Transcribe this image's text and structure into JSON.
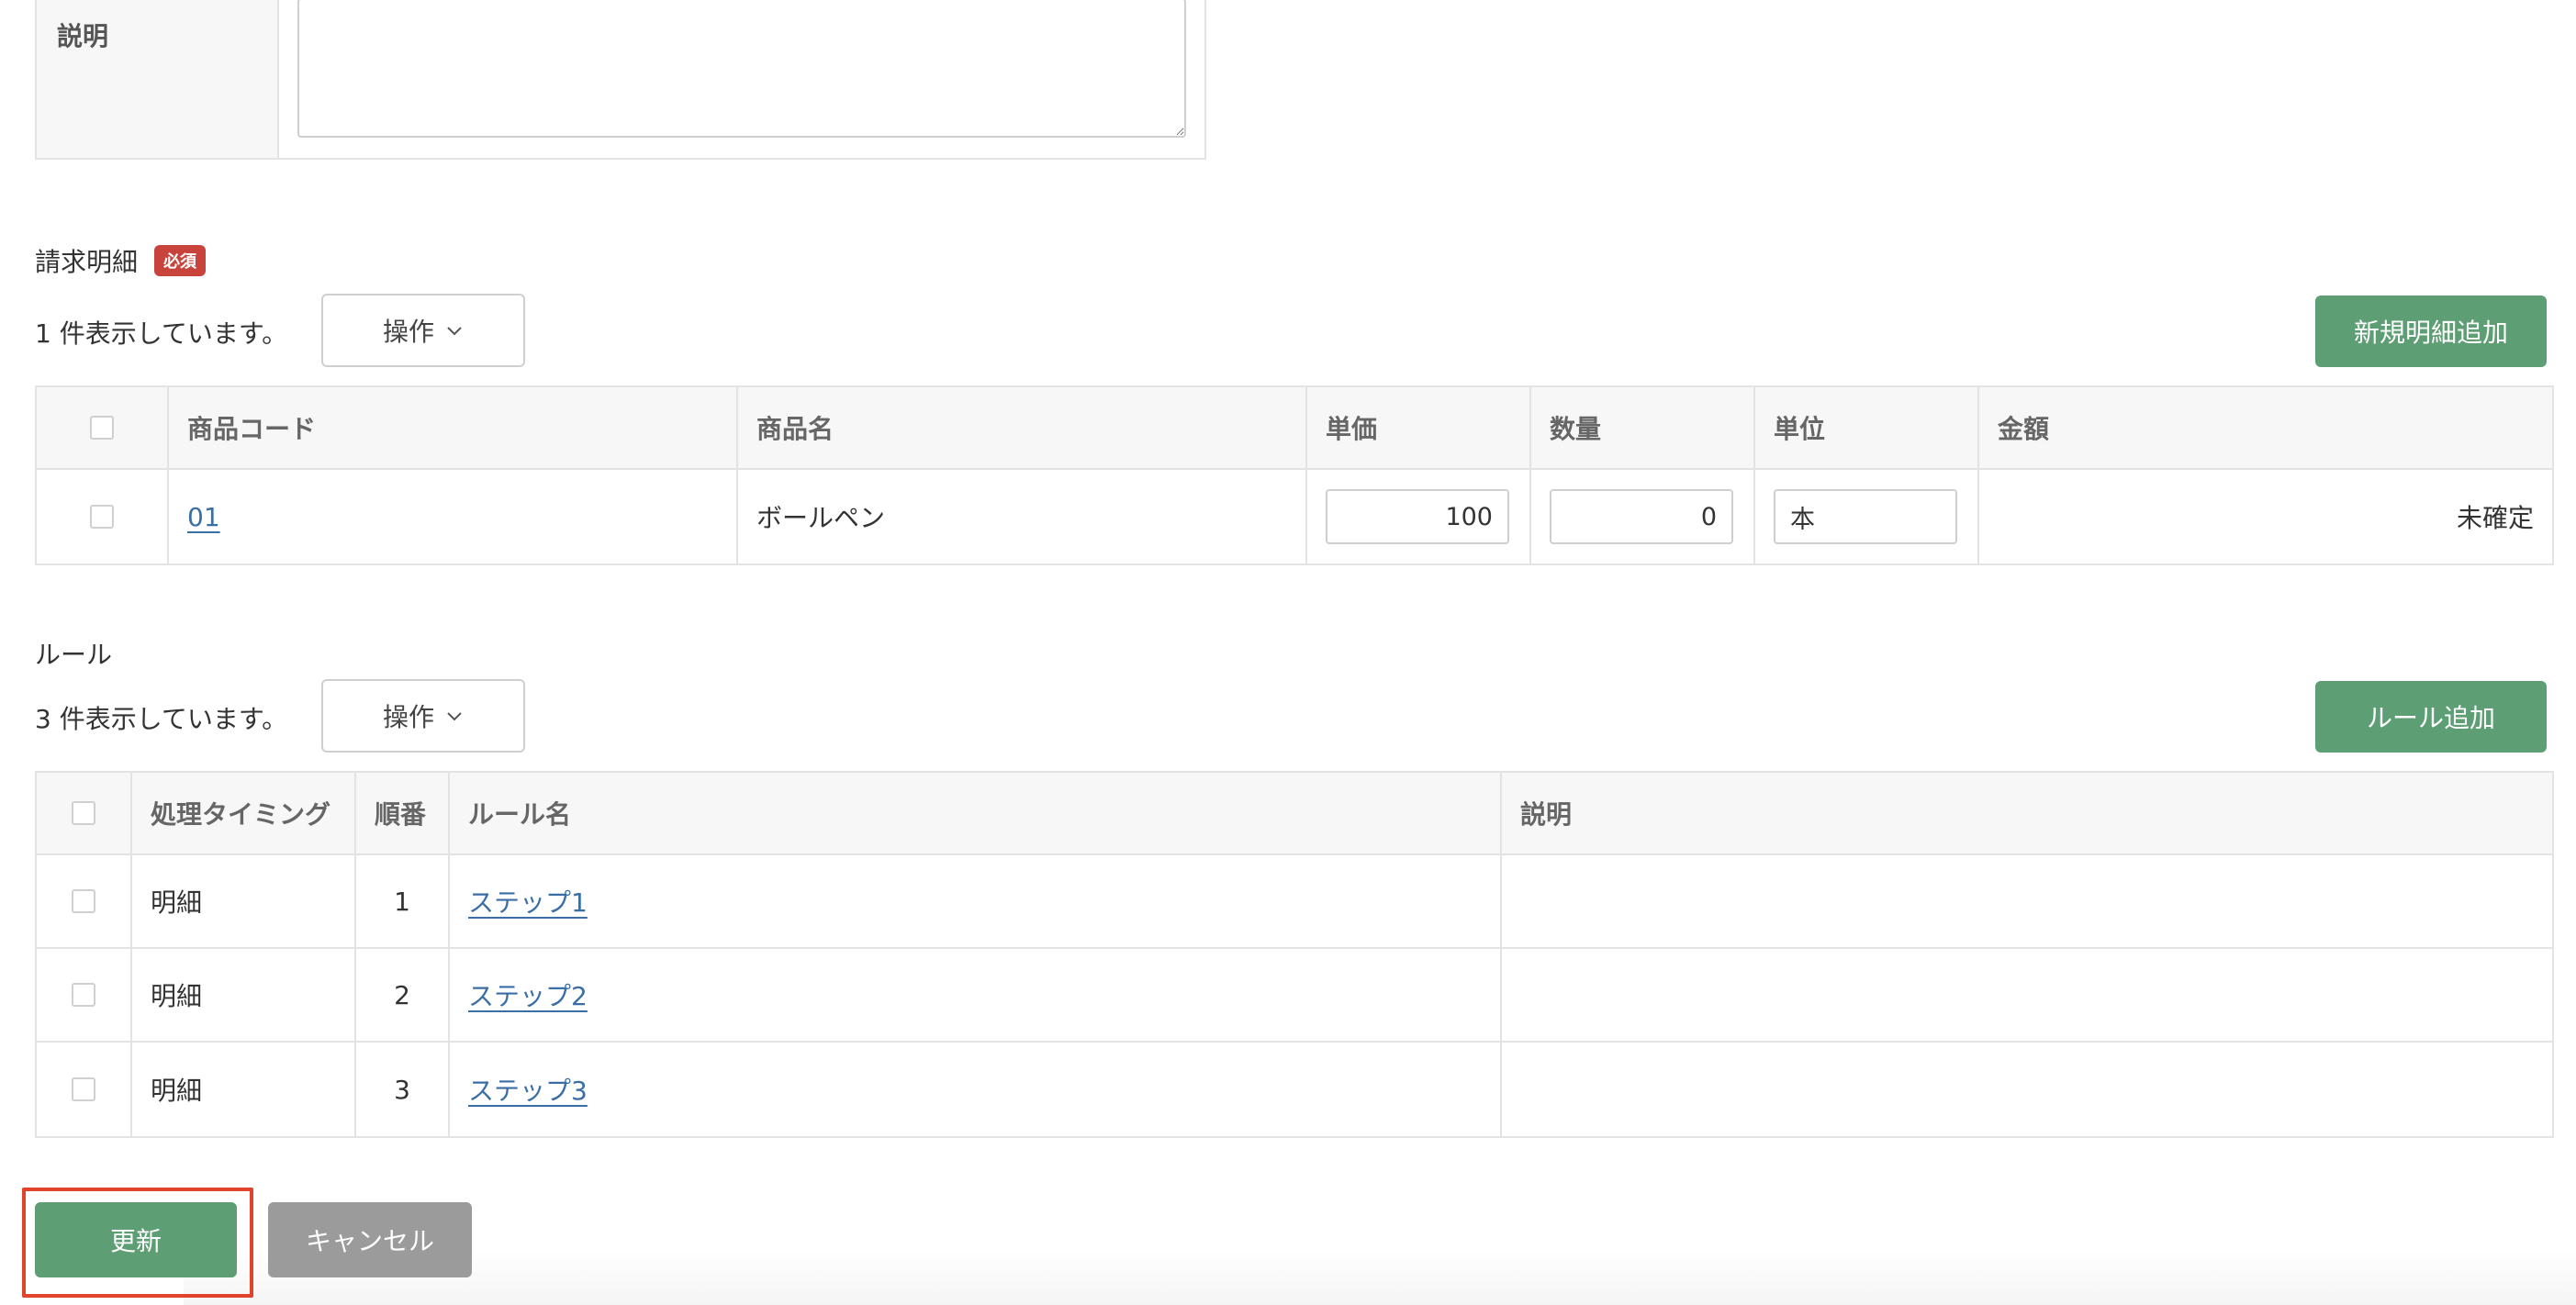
{
  "description_form": {
    "label": "説明",
    "value": ""
  },
  "invoice_section": {
    "title": "請求明細",
    "required_badge": "必須",
    "count_text": "1 件表示しています。",
    "ops_label": "操作",
    "add_button": "新規明細追加",
    "columns": [
      "商品コード",
      "商品名",
      "単価",
      "数量",
      "単位",
      "金額"
    ],
    "rows": [
      {
        "code": "01",
        "name": "ボールペン",
        "unit_price": "100",
        "quantity": "0",
        "unit": "本",
        "amount": "未確定"
      }
    ]
  },
  "rule_section": {
    "title": "ルール",
    "count_text": "3 件表示しています。",
    "ops_label": "操作",
    "add_button": "ルール追加",
    "columns": [
      "処理タイミング",
      "順番",
      "ルール名",
      "説明"
    ],
    "rows": [
      {
        "timing": "明細",
        "order": "1",
        "name": "ステップ1",
        "description": ""
      },
      {
        "timing": "明細",
        "order": "2",
        "name": "ステップ2",
        "description": ""
      },
      {
        "timing": "明細",
        "order": "3",
        "name": "ステップ3",
        "description": ""
      }
    ]
  },
  "actions": {
    "update": "更新",
    "cancel": "キャンセル"
  },
  "colors": {
    "primary_green": "#5e9e74",
    "required_red": "#c8433c",
    "link_blue": "#3a6ea5",
    "cancel_gray": "#9b9b9b",
    "focus_red": "#e0442b"
  },
  "icons": {
    "ops_dropdown": "chevron-down-icon"
  }
}
